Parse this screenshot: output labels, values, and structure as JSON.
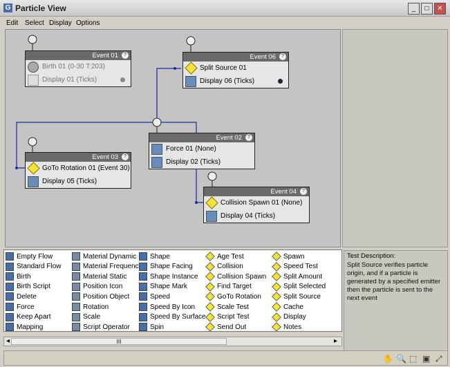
{
  "window": {
    "title": "Particle View",
    "minimize": "_",
    "maximize": "□",
    "close": "✕"
  },
  "menu": [
    "Edit",
    "Select",
    "Display",
    "Options"
  ],
  "events": [
    {
      "id": "event01",
      "title": "Event 01",
      "ops": [
        {
          "label": "Birth 01 (0-30 T:203)",
          "icon": "birth-icon"
        },
        {
          "label": "Display 01 (Ticks)",
          "icon": "display-icon"
        }
      ],
      "disabled": true
    },
    {
      "id": "event06",
      "title": "Event 06",
      "ops": [
        {
          "label": "Split Source 01",
          "icon": "test-icon"
        },
        {
          "label": "Display 06 (Ticks)",
          "icon": "display-icon"
        }
      ]
    },
    {
      "id": "event02",
      "title": "Event 02",
      "ops": [
        {
          "label": "Force 01 (None)",
          "icon": "force-icon"
        },
        {
          "label": "Display 02 (Ticks)",
          "icon": "display-icon"
        }
      ]
    },
    {
      "id": "event03",
      "title": "Event 03",
      "ops": [
        {
          "label": "GoTo Rotation 01 (Event 30)",
          "icon": "test-icon"
        },
        {
          "label": "Display 05 (Ticks)",
          "icon": "display-icon"
        }
      ]
    },
    {
      "id": "event04",
      "title": "Event 04",
      "ops": [
        {
          "label": "Collision Spawn 01 (None)",
          "icon": "test-icon"
        },
        {
          "label": "Display 04 (Ticks)",
          "icon": "display-icon"
        }
      ]
    }
  ],
  "depot": [
    [
      "Empty Flow",
      "Standard Flow",
      "Birth",
      "Birth Script",
      "Delete",
      "Force",
      "Keep Apart",
      "Mapping"
    ],
    [
      "Material Dynamic",
      "Material Frequency",
      "Material Static",
      "Position Icon",
      "Position Object",
      "Rotation",
      "Scale",
      "Script Operator"
    ],
    [
      "Shape",
      "Shape Facing",
      "Shape Instance",
      "Shape Mark",
      "Speed",
      "Speed By Icon",
      "Speed By Surface",
      "Spin"
    ],
    [
      "Age Test",
      "Collision",
      "Collision Spawn",
      "Find Target",
      "GoTo Rotation",
      "Scale Test",
      "Script Test",
      "Send Out"
    ],
    [
      "Spawn",
      "Speed Test",
      "Split Amount",
      "Split Selected",
      "Split Source",
      "Cache",
      "Display",
      "Notes"
    ]
  ],
  "depot_colors": [
    "#4a6ea8",
    "#7a8aa0",
    "#4a6ea8",
    "#f4e23c",
    "#f4e23c"
  ],
  "description": {
    "title": "Test Description:",
    "text": "Split Source verifies particle origin, and if a particle is generated by a specified emitter then the particle is sent to the next event"
  },
  "scrollbar": {
    "left": "◂",
    "right": "▸",
    "thumb": "III"
  },
  "status_icons": [
    "pan-icon",
    "zoom-icon",
    "zoom-region-icon",
    "zoom-extents-icon",
    "no-zoom-icon"
  ],
  "status_glyphs": [
    "✋",
    "🔍",
    "⬚",
    "▣",
    "⤢"
  ]
}
